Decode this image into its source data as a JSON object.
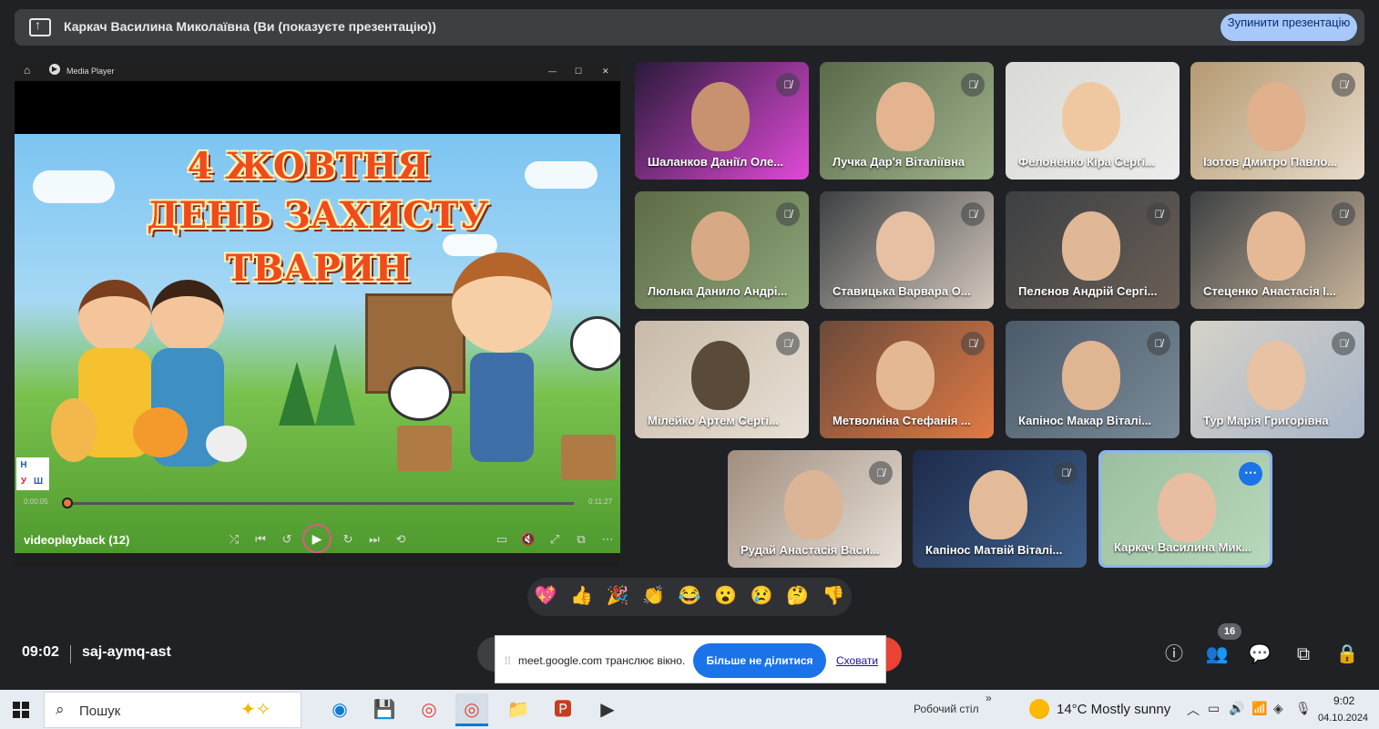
{
  "presenting_bar": {
    "text": "Каркач Василина Миколаївна (Ви (показуєте презентацію))",
    "stop_button": "Зупинити презентацію"
  },
  "player": {
    "title": "Media Player",
    "video_line1": "4 ЖОВТНЯ",
    "video_line2": "ДЕНЬ ЗАХИСТУ",
    "video_line3": "ТВАРИН",
    "logo_letters": [
      "Н",
      "У",
      "Ш"
    ],
    "time_elapsed": "0:00:05",
    "time_total": "0:11:27",
    "progress_fraction": 0.007,
    "video_name": "videoplayback (12)",
    "icons": [
      "home-icon",
      "media-player-icon",
      "minimize-icon",
      "maximize-icon",
      "close-icon",
      "shuffle-icon",
      "previous-icon",
      "rewind-icon",
      "play-icon",
      "forward-icon",
      "next-icon",
      "repeat-icon",
      "subtitles-icon",
      "volume-mute-icon",
      "fullscreen-icon",
      "miniplayer-icon",
      "more-icon"
    ]
  },
  "participants": [
    {
      "name": "Шаланков Даніїл Оле...",
      "muted": true
    },
    {
      "name": "Лучка Дар'я Віталіївна",
      "muted": true
    },
    {
      "name": "Фелоненко Кіра Сергі...",
      "muted": false
    },
    {
      "name": "Ізотов Дмитро Павло...",
      "muted": true
    },
    {
      "name": "Люлька Данило Андрі...",
      "muted": true
    },
    {
      "name": "Ставицька Варвара О...",
      "muted": true
    },
    {
      "name": "Пелєнов Андрій Сергі...",
      "muted": true
    },
    {
      "name": "Стеценко Анастасія І...",
      "muted": true
    },
    {
      "name": "Мілейко Артем Сергі...",
      "muted": true
    },
    {
      "name": "Метволкіна Стефанія ...",
      "muted": true
    },
    {
      "name": "Капінос Макар Віталі...",
      "muted": true
    },
    {
      "name": "Тур Марія Григорівна",
      "muted": true
    },
    {
      "name": "Рудай Анастасія Васи...",
      "muted": true
    },
    {
      "name": "Капінос Матвій Віталі...",
      "muted": true
    },
    {
      "name": "Каркач Василина Мик...",
      "muted": false,
      "active": true
    }
  ],
  "reactions": [
    "💖",
    "👍",
    "🎉",
    "👏",
    "😂",
    "😮",
    "😢",
    "🤔",
    "👎"
  ],
  "meeting": {
    "time": "09:02",
    "code": "saj-aymq-ast",
    "people_count": "16"
  },
  "share_notice": {
    "text": "meet.google.com транслює вікно.",
    "stop_button": "Більше не ділитися",
    "hide_link": "Сховати"
  },
  "taskbar": {
    "search_placeholder": "Пошук",
    "desktop_label": "Робочий стіл",
    "weather": "14°C  Mostly sunny",
    "time": "9:02",
    "date": "04.10.2024"
  },
  "colors": {
    "meet_bg": "#202124",
    "accent_blue": "#1a73e8",
    "stop_present_bg": "#a8c7fa",
    "leave_red": "#ea4335",
    "title_orange": "#f14a1c"
  }
}
